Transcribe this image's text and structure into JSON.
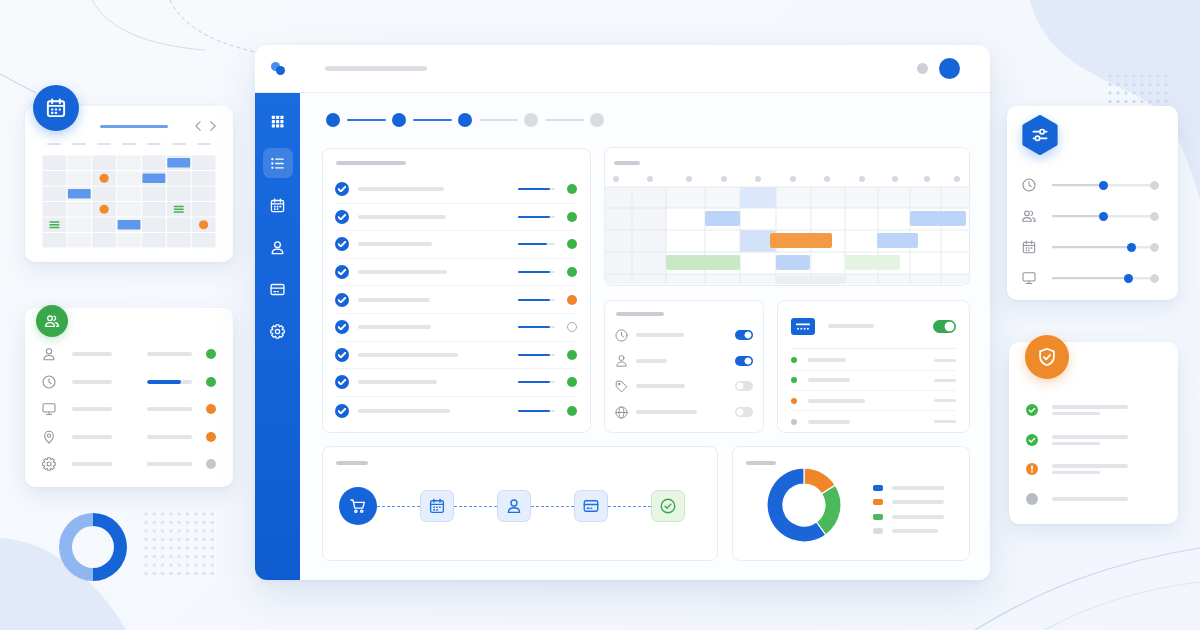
{
  "people_card": {
    "rows": [
      {
        "kind": "text",
        "color": "#3bb54a"
      },
      {
        "kind": "progress",
        "level": 0.75,
        "color": "#3bb54a"
      },
      {
        "kind": "text",
        "color": "#f0862a"
      },
      {
        "kind": "text",
        "color": "#f0862a"
      },
      {
        "kind": "text",
        "color": "#c4c7cd"
      }
    ]
  },
  "main_window": {
    "sidebar": {
      "items": [
        {
          "selected": false
        },
        {
          "selected": true
        },
        {
          "selected": false
        },
        {
          "selected": false
        },
        {
          "selected": false
        },
        {
          "selected": false
        }
      ]
    },
    "stepper": {
      "steps": [
        {
          "done": true
        },
        {
          "done": true
        },
        {
          "done": true
        },
        {
          "done": false
        },
        {
          "done": false
        }
      ]
    },
    "task_list": {
      "rows": [
        {
          "checked": true,
          "level": 0.86,
          "status": {
            "color": "#3bb54a",
            "filled": true
          }
        },
        {
          "checked": true,
          "level": 0.86,
          "status": {
            "color": "#3bb54a",
            "filled": true
          }
        },
        {
          "checked": true,
          "level": 0.78,
          "status": {
            "color": "#3bb54a",
            "filled": true
          }
        },
        {
          "checked": true,
          "level": 0.86,
          "status": {
            "color": "#3bb54a",
            "filled": true
          }
        },
        {
          "checked": true,
          "level": 0.86,
          "status": {
            "color": "#f0862a",
            "filled": true
          }
        },
        {
          "checked": true,
          "level": 0.86,
          "status": {
            "color": "#a9aeb6",
            "filled": false
          }
        },
        {
          "checked": true,
          "level": 0.86,
          "status": {
            "color": "#3bb54a",
            "filled": true
          }
        },
        {
          "checked": true,
          "level": 0.86,
          "status": {
            "color": "#3bb54a",
            "filled": true
          }
        },
        {
          "checked": true,
          "level": 0.86,
          "status": {
            "color": "#3bb54a",
            "filled": true
          }
        }
      ]
    },
    "settings_panel": {
      "toggles": [
        {
          "on": true
        },
        {
          "on": true
        },
        {
          "on": false
        },
        {
          "on": false
        }
      ]
    },
    "status_panel": {
      "switch": {
        "on": true
      },
      "items": [
        {
          "color": "#3bb54a"
        },
        {
          "color": "#3bb54a"
        },
        {
          "color": "#f0862a"
        },
        {
          "color": "#c4c7cd"
        }
      ]
    },
    "workflow": {
      "steps": [
        {
          "kind": "current"
        },
        {
          "kind": "pending"
        },
        {
          "kind": "pending"
        },
        {
          "kind": "pending"
        },
        {
          "kind": "complete"
        }
      ]
    },
    "breakdown": {
      "legend": [
        {
          "color": "#1a66d9"
        },
        {
          "color": "#f0862a"
        },
        {
          "color": "#4cb85c"
        },
        {
          "color": "#d9dce1"
        }
      ]
    }
  },
  "sliders_card": {
    "sliders": [
      {
        "level": 0.5
      },
      {
        "level": 0.5
      },
      {
        "level": 0.78
      },
      {
        "level": 0.75
      }
    ]
  },
  "security_card": {
    "checks": [
      {
        "kind": "ok",
        "color": "#3bb54a"
      },
      {
        "kind": "ok",
        "color": "#3bb54a"
      },
      {
        "kind": "warning",
        "color": "#f0862a"
      },
      {
        "kind": "pending",
        "color": "#b9bdc5"
      }
    ]
  }
}
